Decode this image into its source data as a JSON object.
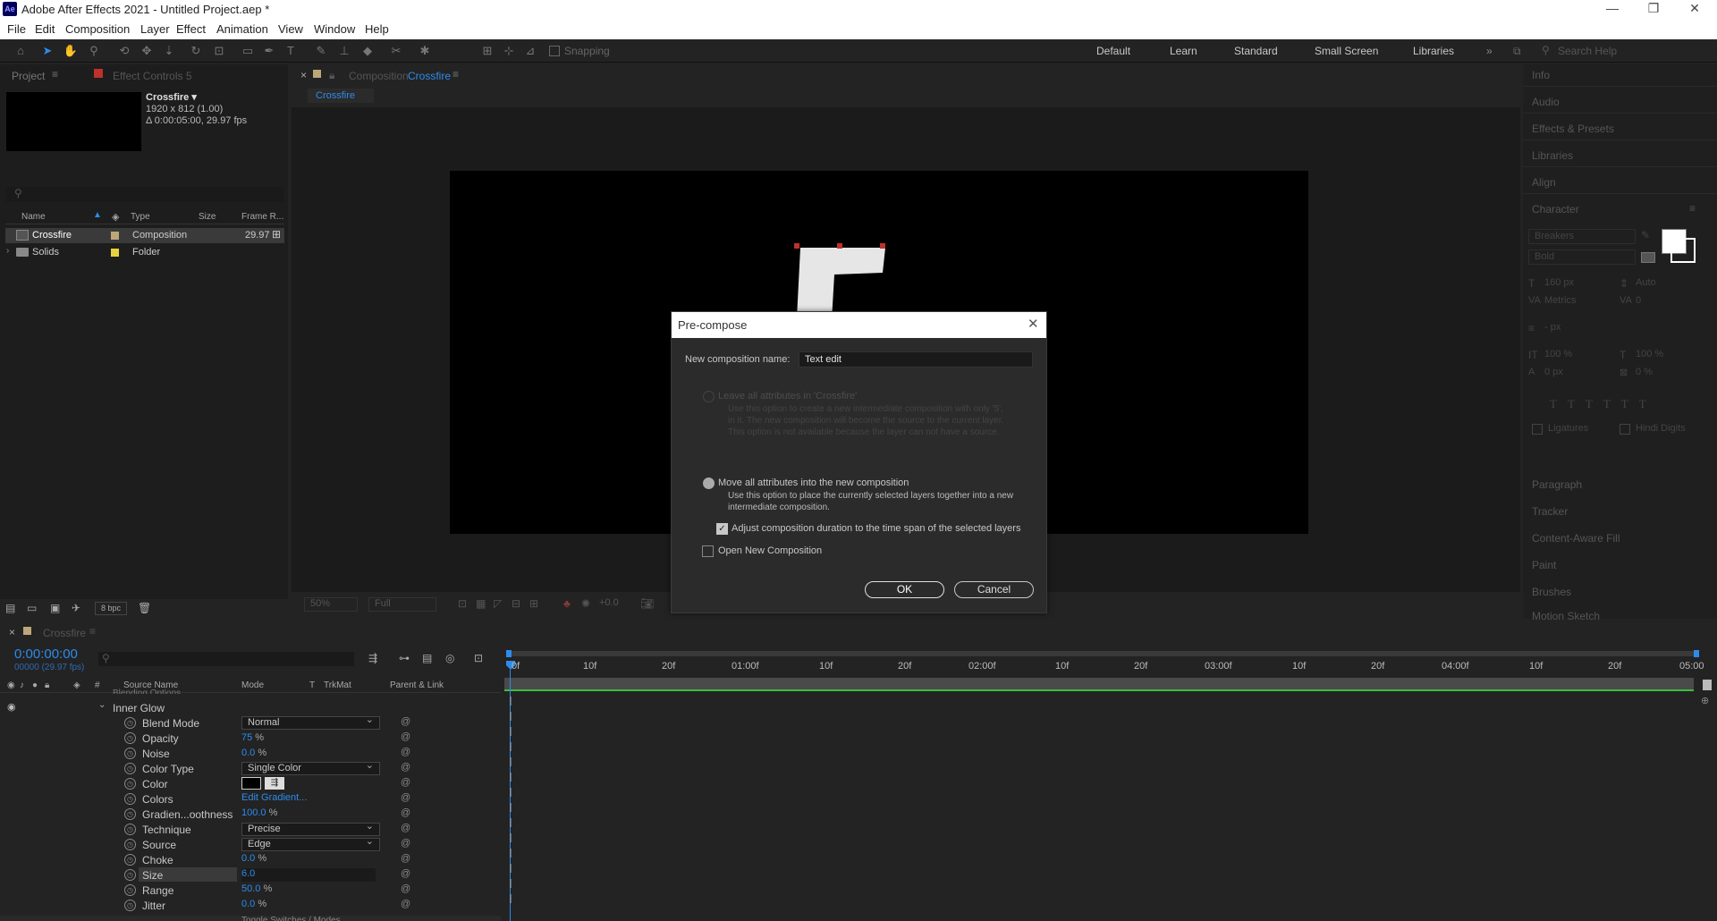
{
  "window": {
    "title": "Adobe After Effects 2021 - Untitled Project.aep *",
    "logo": "Ae"
  },
  "menu": [
    "File",
    "Edit",
    "Composition",
    "Layer",
    "Effect",
    "Animation",
    "View",
    "Window",
    "Help"
  ],
  "toolbar": {
    "snapping": "Snapping",
    "workspaces": [
      "Default",
      "Learn",
      "Standard",
      "Small Screen",
      "Libraries"
    ],
    "search_placeholder": "Search Help"
  },
  "project": {
    "tab_project": "Project",
    "tab_effects": "Effect Controls 5",
    "comp_name": "Crossfire ▾",
    "comp_size": "1920 x 812 (1.00)",
    "comp_dur": "Δ 0:00:05:00, 29.97 fps",
    "columns": [
      "Name",
      "Type",
      "Size",
      "Frame R..."
    ],
    "items": [
      {
        "name": "Crossfire",
        "type": "Composition",
        "fps": "29.97"
      },
      {
        "name": "Solids",
        "type": "Folder",
        "fps": ""
      }
    ],
    "bpc": "8 bpc"
  },
  "comp": {
    "tab_prefix": "Composition",
    "tab_name": "Crossfire",
    "sub_tab": "Crossfire",
    "zoom": "50%",
    "res": "Full",
    "exposure": "+0.0"
  },
  "dialog": {
    "title": "Pre-compose",
    "name_label": "New composition name:",
    "name_value": "Text edit",
    "opt1_title": "Leave all attributes in 'Crossfire'",
    "opt1_desc1": "Use this option to create a new intermediate composition with only '5',",
    "opt1_desc2": "in it. The new composition will become the source to the current layer.",
    "opt1_desc3": "This option is not available because the layer can not have a source.",
    "opt2_title": "Move all attributes into the new composition",
    "opt2_desc1": "Use this option to place the currently selected layers together into a new",
    "opt2_desc2": "intermediate composition.",
    "adjust": "Adjust composition duration to the time span of the selected layers",
    "open_new": "Open New Composition",
    "ok": "OK",
    "cancel": "Cancel"
  },
  "timeline": {
    "tab": "Crossfire",
    "time": "0:00:00:00",
    "frames": "00000 (29.97 fps)",
    "cols": [
      "Source Name",
      "Mode",
      "T",
      "TrkMat",
      "Parent & Link"
    ],
    "partial": "Blending Options",
    "group": "Inner Glow",
    "props": [
      {
        "name": "Blend Mode",
        "value": "Normal"
      },
      {
        "name": "Opacity",
        "value": "75",
        "unit": " %"
      },
      {
        "name": "Noise",
        "value": "0.0",
        "unit": " %"
      },
      {
        "name": "Color Type",
        "value": "Single Color"
      },
      {
        "name": "Color",
        "value": ""
      },
      {
        "name": "Colors",
        "value": "Edit Gradient..."
      },
      {
        "name": "Gradien...oothness",
        "value": "100.0",
        "unit": " %"
      },
      {
        "name": "Technique",
        "value": "Precise"
      },
      {
        "name": "Source",
        "value": "Edge"
      },
      {
        "name": "Choke",
        "value": "0.0",
        "unit": " %"
      },
      {
        "name": "Size",
        "value": "6.0",
        "unit": ""
      },
      {
        "name": "Range",
        "value": "50.0",
        "unit": " %"
      },
      {
        "name": "Jitter",
        "value": "0.0",
        "unit": " %"
      }
    ],
    "ruler": [
      "0f",
      "10f",
      "20f",
      "01:00f",
      "10f",
      "20f",
      "02:00f",
      "10f",
      "20f",
      "03:00f",
      "10f",
      "20f",
      "04:00f",
      "10f",
      "20f",
      "05:00"
    ],
    "footer": "Toggle Switches / Modes"
  },
  "right": {
    "panels": [
      "Info",
      "Audio",
      "Effects & Presets",
      "Libraries",
      "Align",
      "Character"
    ],
    "char": {
      "font": "Breakers",
      "style": "Bold",
      "size": "160 px",
      "leading": "Auto",
      "kern": "Metrics",
      "track": "0",
      "stroke": "- px",
      "vscale": "100 %",
      "hscale": "100 %",
      "baseline": "0 px",
      "tsume": "0 %",
      "ligatures": "Ligatures",
      "hindi": "Hindi Digits"
    },
    "panels2": [
      "Paragraph",
      "Tracker",
      "Content-Aware Fill",
      "Paint",
      "Brushes",
      "Motion Sketch"
    ]
  },
  "colors": {
    "accent": "#2d8ceb",
    "bg": "#232323"
  }
}
